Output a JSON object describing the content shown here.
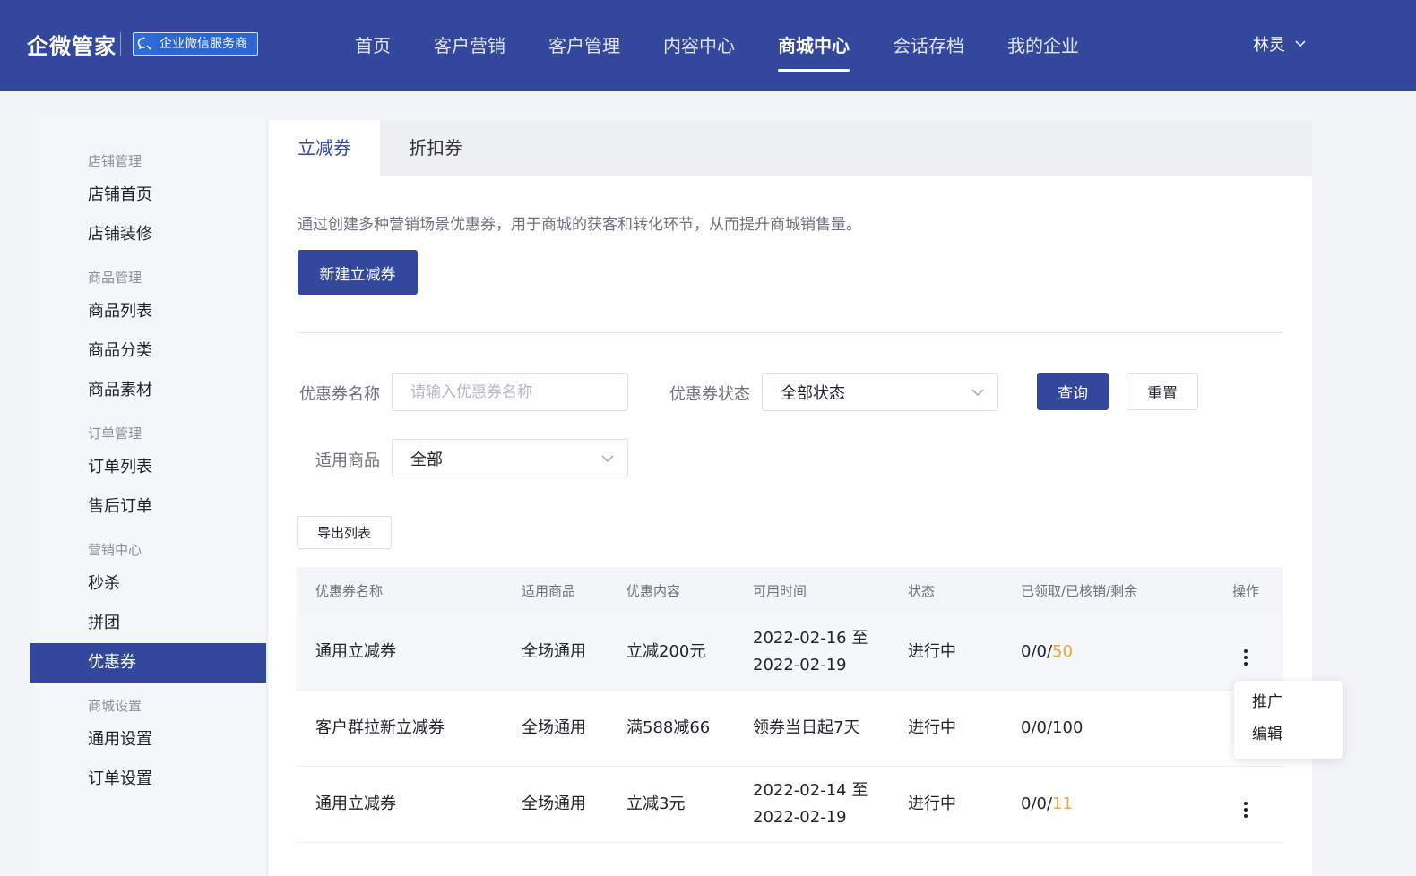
{
  "header": {
    "brand": "企微管家",
    "badge": "企业微信服务商",
    "nav": [
      "首页",
      "客户营销",
      "客户管理",
      "内容中心",
      "商城中心",
      "会话存档",
      "我的企业"
    ],
    "active_nav": "商城中心",
    "user": "林灵",
    "colors": {
      "primary": "#33479d",
      "accent": "#f0a33e"
    }
  },
  "sidebar": {
    "groups": [
      {
        "title": "店铺管理",
        "items": [
          "店铺首页",
          "店铺装修"
        ]
      },
      {
        "title": "商品管理",
        "items": [
          "商品列表",
          "商品分类",
          "商品素材"
        ]
      },
      {
        "title": "订单管理",
        "items": [
          "订单列表",
          "售后订单"
        ]
      },
      {
        "title": "营销中心",
        "items": [
          "秒杀",
          "拼团",
          "优惠券"
        ]
      },
      {
        "title": "商城设置",
        "items": [
          "通用设置",
          "订单设置"
        ]
      }
    ],
    "active": "优惠券"
  },
  "main": {
    "tabs": [
      "立减券",
      "折扣券"
    ],
    "active_tab": "立减券",
    "description": "通过创建多种营销场景优惠券，用于商城的获客和转化环节，从而提升商城销售量。",
    "create_button": "新建立减券",
    "filters": {
      "name_label": "优惠券名称",
      "name_placeholder": "请输入优惠券名称",
      "status_label": "优惠券状态",
      "status_value": "全部状态",
      "goods_label": "适用商品",
      "goods_value": "全部",
      "query": "查询",
      "reset": "重置"
    },
    "export_button": "导出列表",
    "table": {
      "headers": [
        "优惠券名称",
        "适用商品",
        "优惠内容",
        "可用时间",
        "状态",
        "已领取/已核销/剩余",
        "操作"
      ],
      "rows": [
        {
          "name": "通用立减券",
          "goods": "全场通用",
          "content": "立减200元",
          "time1": "2022-02-16 至",
          "time2": "2022-02-19",
          "status": "进行中",
          "stats_prefix": "0/0/",
          "remaining": "50"
        },
        {
          "name": "客户群拉新立减券",
          "goods": "全场通用",
          "content": "满588减66",
          "time1": "领券当日起7天",
          "time2": "",
          "status": "进行中",
          "stats_prefix": "0/0/100",
          "remaining": ""
        },
        {
          "name": "通用立减券",
          "goods": "全场通用",
          "content": "立减3元",
          "time1": "2022-02-14 至",
          "time2": "2022-02-19",
          "status": "进行中",
          "stats_prefix": "0/0/",
          "remaining": "11"
        }
      ]
    },
    "popover": [
      "推广",
      "编辑"
    ]
  }
}
